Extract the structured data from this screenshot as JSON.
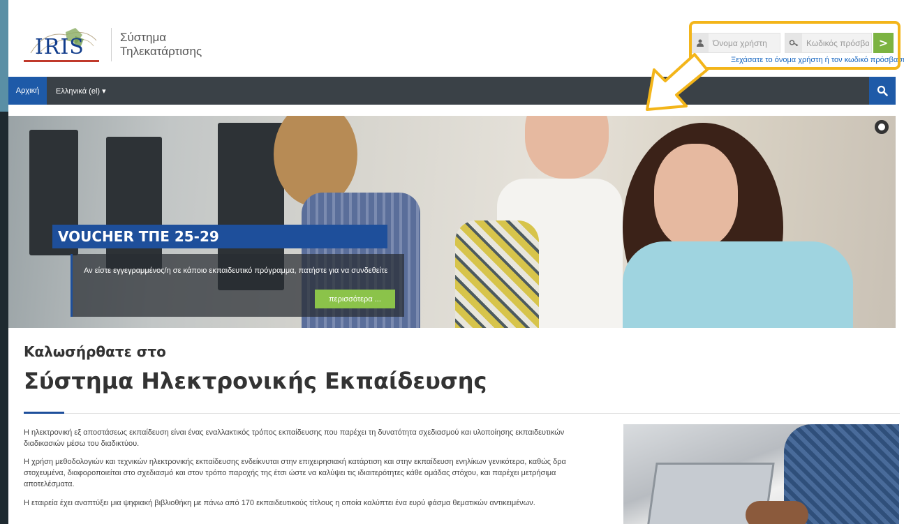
{
  "header": {
    "logo_text": "IRIS",
    "site_name_line1": "Σύστημα",
    "site_name_line2": "Τηλεκατάρτισης"
  },
  "login": {
    "username_placeholder": "Όνομα χρήστη",
    "password_placeholder": "Κωδικός πρόσβασης",
    "submit_label": ">",
    "forgot_link": "Ξεχάσατε το όνομα χρήστη ή τον κωδικό πρόσβασης;",
    "highlight_color": "#f3b51a"
  },
  "navbar": {
    "home_label": "Αρχική",
    "language_label": "Ελληνικά (el) ▾",
    "bg_color": "#3a4147",
    "accent_color": "#1e5aa8"
  },
  "hero": {
    "title": "VOUCHER ΤΠΕ 25-29",
    "caption": "Αν είστε εγγεγραμμένος/η σε κάποιο εκπαιδευτικό πρόγραμμα, πατήστε για να συνδεθείτε",
    "more_button": "περισσότερα ..."
  },
  "welcome": {
    "subtitle": "Καλωσήρθατε στο",
    "title": "Σύστημα Ηλεκτρονικής Εκπαίδευσης",
    "paragraph1": "Η ηλεκτρονική εξ αποστάσεως εκπαίδευση είναι ένας εναλλακτικός τρόπος εκπαίδευσης που παρέχει τη δυνατότητα σχεδιασμού και υλοποίησης εκπαιδευτικών διαδικασιών μέσω του διαδικτύου.",
    "paragraph2": "Η χρήση μεθοδολογιών και τεχνικών ηλεκτρονικής εκπαίδευσης ενδείκνυται στην επιχειρησιακή κατάρτιση και στην εκπαίδευση ενηλίκων γενικότερα, καθώς δρα στοχευμένα, διαφοροποιείται στο σχεδιασμό και στον τρόπο παροχής της έτσι ώστε να καλύψει τις ιδιαιτερότητες κάθε ομάδας στόχου, και παρέχει μετρήσιμα αποτελέσματα.",
    "paragraph3": "Η εταιρεία έχει αναπτύξει μια ψηφιακή βιβλιοθήκη με πάνω από 170 εκπαιδευτικούς τίτλους η οποία καλύπτει ένα ευρύ φάσμα θεματικών αντικειμένων."
  },
  "icons": {
    "user": "user-icon",
    "key": "key-icon",
    "search": "search-icon",
    "pointer_arrow": "arrow-icon"
  }
}
